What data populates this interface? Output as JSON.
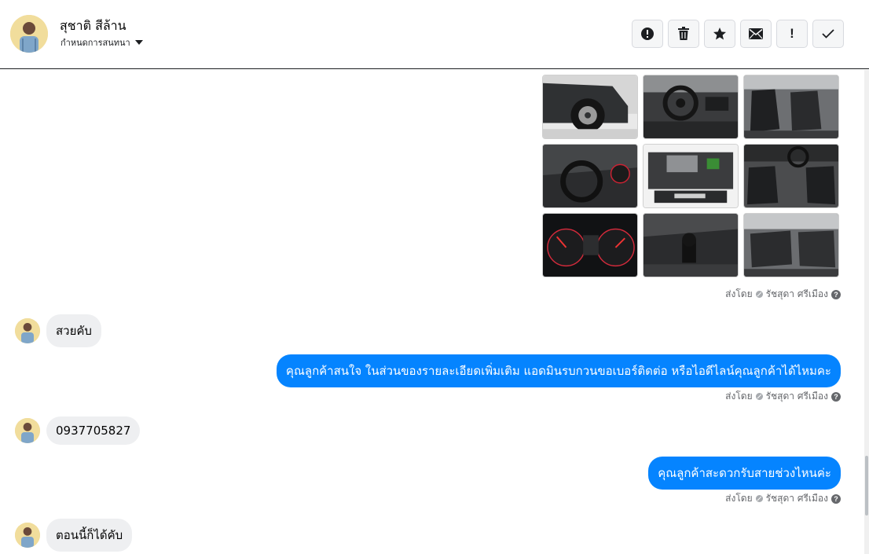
{
  "header": {
    "contact_name": "สุชาติ สีล้าน",
    "assign_label": "กำหนดการสนทนา"
  },
  "toolbar": {
    "buttons": [
      {
        "name": "spam",
        "icon": "exclamation-circle-icon"
      },
      {
        "name": "delete",
        "icon": "trash-icon"
      },
      {
        "name": "star",
        "icon": "star-icon"
      },
      {
        "name": "mark-unread",
        "icon": "envelope-icon"
      },
      {
        "name": "mark-important",
        "icon": "exclamation-icon"
      },
      {
        "name": "mark-done",
        "icon": "check-icon"
      }
    ]
  },
  "photos": [
    "car-front-wheel",
    "steering-wheel",
    "front-seats",
    "gauge-cluster",
    "engine-bay",
    "cabin-interior",
    "speedometer",
    "gear-shifter",
    "rear-seats"
  ],
  "messages": [
    {
      "type": "sent_meta",
      "sent_by_label": "ส่งโดย",
      "agent": "รัชสุดา ศรีเมือง"
    },
    {
      "type": "incoming",
      "text": "สวยคับ"
    },
    {
      "type": "outgoing",
      "text": "คุณลูกค้าสนใจ ในส่วนของรายละเอียดเพิ่มเติม แอดมินรบกวนขอเบอร์ติดต่อ หรือไอดีไลน์คุณลูกค้าได้ไหมคะ",
      "sent_by_label": "ส่งโดย",
      "agent": "รัชสุดา ศรีเมือง"
    },
    {
      "type": "incoming",
      "text": "0937705827"
    },
    {
      "type": "outgoing",
      "text": "คุณลูกค้าสะดวกรับสายช่วงไหนค่ะ",
      "sent_by_label": "ส่งโดย",
      "agent": "รัชสุดา ศรีเมือง"
    },
    {
      "type": "incoming",
      "text": "ตอนนี้ก็ได้คับ"
    }
  ],
  "colors": {
    "outgoing_bubble": "#0584ff",
    "incoming_bubble": "#eeeff1"
  }
}
